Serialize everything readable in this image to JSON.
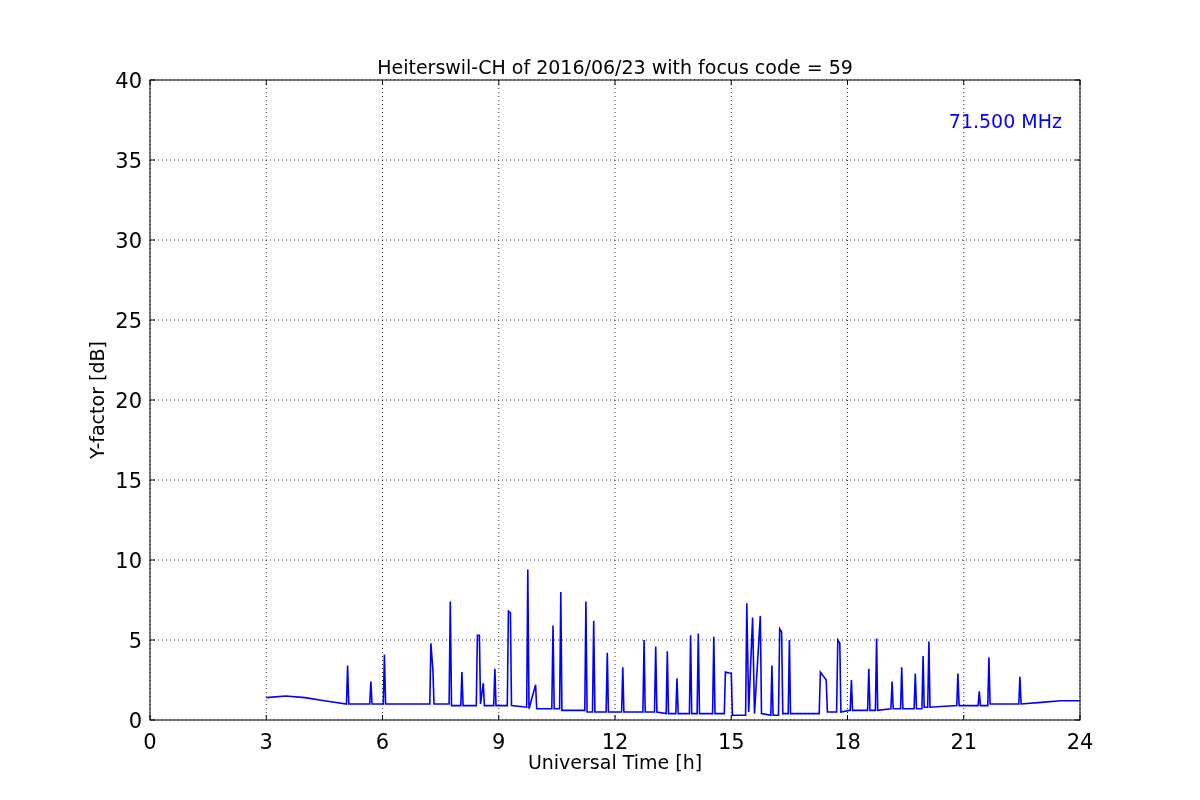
{
  "chart": {
    "chart_data": {
      "type": "line",
      "title": "Heiterswil-CH of 2016/06/23 with focus code = 59",
      "xlabel": "Universal Time [h]",
      "ylabel": "Y-factor [dB]",
      "xlim": [
        0,
        24
      ],
      "ylim": [
        0,
        40
      ],
      "grid": true,
      "xticks": [
        0,
        3,
        6,
        9,
        12,
        15,
        18,
        21,
        24
      ],
      "yticks": [
        0,
        5,
        10,
        15,
        20,
        25,
        30,
        35,
        40
      ],
      "x": [
        3,
        3.5,
        4,
        4.5,
        5.07,
        5.1,
        5.13,
        5.67,
        5.7,
        5.73,
        6.02,
        6.05,
        6.08,
        7.22,
        7.25,
        7.3,
        7.33,
        7.72,
        7.75,
        7.78,
        8.02,
        8.05,
        8.08,
        8.42,
        8.45,
        8.5,
        8.53,
        8.6,
        8.63,
        8.87,
        8.9,
        8.93,
        9.22,
        9.25,
        9.3,
        9.33,
        9.72,
        9.75,
        9.78,
        9.95,
        9.98,
        10.37,
        10.4,
        10.43,
        10.57,
        10.6,
        10.63,
        11.22,
        11.25,
        11.28,
        11.42,
        11.45,
        11.48,
        11.77,
        11.8,
        11.83,
        12.17,
        12.2,
        12.23,
        12.72,
        12.75,
        12.78,
        13.02,
        13.05,
        13.08,
        13.32,
        13.35,
        13.38,
        13.57,
        13.6,
        13.63,
        13.92,
        13.95,
        13.98,
        14.12,
        14.15,
        14.18,
        14.52,
        14.55,
        14.58,
        14.82,
        14.85,
        15.0,
        15.03,
        15.37,
        15.4,
        15.45,
        15.55,
        15.6,
        15.75,
        15.78,
        16.02,
        16.05,
        16.08,
        16.22,
        16.25,
        16.3,
        16.33,
        16.47,
        16.5,
        16.53,
        17.27,
        17.3,
        17.45,
        17.48,
        17.72,
        17.75,
        17.8,
        17.83,
        18.07,
        18.1,
        18.13,
        18.52,
        18.55,
        18.58,
        18.72,
        18.75,
        18.78,
        19.12,
        19.15,
        19.18,
        19.37,
        19.4,
        19.43,
        19.72,
        19.75,
        19.78,
        19.92,
        19.95,
        19.98,
        20.07,
        20.1,
        20.13,
        20.82,
        20.85,
        20.88,
        21.37,
        21.4,
        21.43,
        21.62,
        21.65,
        21.68,
        22.42,
        22.45,
        22.48,
        23,
        23.5,
        24
      ],
      "series": [
        {
          "name": "71.500 MHz",
          "color": "#0000ff",
          "values": [
            1.4,
            1.5,
            1.4,
            1.2,
            1.0,
            3.4,
            1.0,
            1.0,
            2.4,
            1.0,
            1.0,
            4.1,
            1.0,
            1.0,
            4.8,
            3.1,
            1.0,
            1.0,
            7.4,
            0.9,
            0.9,
            3.0,
            0.9,
            0.9,
            5.3,
            5.3,
            1.0,
            2.3,
            0.9,
            0.9,
            3.2,
            0.9,
            0.9,
            6.8,
            6.7,
            0.9,
            0.8,
            9.4,
            0.7,
            2.2,
            0.7,
            0.7,
            5.9,
            0.7,
            0.7,
            8.0,
            0.6,
            0.6,
            7.4,
            0.5,
            0.5,
            6.2,
            0.5,
            0.5,
            4.2,
            0.5,
            0.5,
            3.3,
            0.5,
            0.5,
            5.0,
            0.5,
            0.5,
            4.6,
            0.5,
            0.4,
            4.3,
            0.4,
            0.4,
            2.6,
            0.4,
            0.4,
            5.3,
            0.4,
            0.4,
            5.4,
            0.4,
            0.4,
            5.2,
            0.4,
            0.4,
            3.0,
            2.9,
            0.3,
            0.3,
            7.3,
            0.5,
            6.4,
            0.4,
            6.5,
            0.4,
            0.3,
            3.4,
            0.3,
            0.3,
            5.7,
            5.5,
            0.4,
            0.4,
            5.0,
            0.4,
            0.4,
            3.0,
            2.5,
            0.5,
            0.5,
            5.0,
            4.8,
            0.5,
            0.6,
            2.5,
            0.6,
            0.6,
            3.2,
            0.6,
            0.6,
            5.1,
            0.6,
            0.7,
            2.4,
            0.7,
            0.7,
            3.3,
            0.7,
            0.7,
            2.9,
            0.7,
            0.7,
            4.0,
            0.8,
            0.8,
            4.9,
            0.8,
            0.9,
            2.9,
            0.9,
            0.9,
            1.8,
            0.9,
            0.9,
            3.9,
            1.0,
            1.0,
            2.7,
            1.0,
            1.1,
            1.2,
            1.2
          ]
        }
      ]
    }
  }
}
